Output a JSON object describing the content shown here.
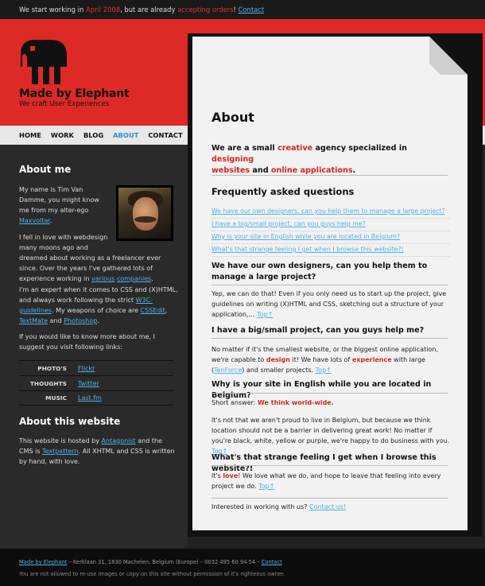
{
  "topbar": {
    "text1": "We start working in ",
    "date": "April 2008",
    "text2": ", but are already ",
    "accepting": "accepting orders",
    "text3": "! ",
    "contact": "Contact"
  },
  "brand": {
    "name": "Made by Elephant",
    "tagline": "We craft User Experiences"
  },
  "nav": {
    "items": [
      "HOME",
      "WORK",
      "BLOG",
      "ABOUT",
      "CONTACT"
    ],
    "active": "ABOUT"
  },
  "sidebar": {
    "about_title": "About me",
    "p1_a": "My name is Tim Van",
    "p1_b": "Damme, you might know",
    "p1_c": "me from my alter-ego",
    "p1_link": "Maxvoltar",
    "p1_end": ".",
    "p2_a": "I fell in love with webdesign",
    "p2_b": "many moons ago and",
    "p2_c": "dreamed about working as a freelancer ever",
    "p2_d": "since. Over the years I've gathered lots of",
    "p2_e": "experience working in ",
    "p2_link1": "various",
    "p2_link2": "companies",
    "p2_end": ".",
    "p3_a": "I'm an expert when it comes to CSS and (X)HTML,",
    "p3_b": "and always work following the strict ",
    "p3_link1": "W3C-",
    "p3_link1b": "guidelines",
    "p3_c": ". My weapons of choice are ",
    "p3_link2": "CSSEdit",
    "p3_link3": "TextMate",
    "p3_d": " and ",
    "p3_link4": "Photoshop",
    "p3_end": ".",
    "p4_a": "If you would like to know more about me, I",
    "p4_b": "suggest you visit following links:",
    "links": [
      {
        "label": "PHOTO'S",
        "link": "Flickr"
      },
      {
        "label": "THOUGHTS",
        "link": "Twitter"
      },
      {
        "label": "MUSIC",
        "link": "Last.fm"
      }
    ],
    "site_title": "About this website",
    "s_a": "This website is hosted by ",
    "s_link1": "Antagonist",
    "s_b": " and the",
    "s_c": "CMS is ",
    "s_link2": "Textpattern",
    "s_d": ". All XHTML and CSS is written",
    "s_e": "by hand, with love."
  },
  "content": {
    "title": "About",
    "intro_1": "We are a small ",
    "intro_creative": "creative",
    "intro_2": " agency specialized in ",
    "intro_designing": "designing",
    "intro_websites": "websites",
    "intro_3": " and ",
    "intro_apps": "online applications",
    "intro_4": ".",
    "faq_title": "Frequently asked questions",
    "faq": [
      "We have our own designers, can you help them to manage a large project?",
      "I have a big/small project, can you guys help me?",
      "Why is your site in English while you are located in Belgium?",
      "What's that strange feeling I get when I browse this website?!"
    ],
    "q1_title": "We have our own designers, can you help them to manage a large project?",
    "q1_a": "Yep, we can do that! Even if you only need us to start up the project, give guidelines on writing (X)HTML and CSS, sketching out a structure of your application,… ",
    "top": "Top↑",
    "q2_title": "I have a big/small project, can you guys help me?",
    "q2_a": "No matter if it's the smallest website, or the biggest online application, we're capable to ",
    "q2_design": "design",
    "q2_b": " it! We have lots of ",
    "q2_exp": "experience",
    "q2_c": " with large (",
    "q2_link": "TenForce",
    "q2_d": ") and smaller projects. ",
    "q3_title": "Why is your site in English while you are located in Belgium?",
    "q3_short": "Short answer: ",
    "q3_ww": "We think world-wide.",
    "q3_a": "It's not that we aren't proud to live in Belgium, but because we think location should not be a barrier in delivering great work! No matter if you're black, white, yellow or purple, we're happy to do business with you. ",
    "q4_title": "What's that strange feeling I get when I browse this website?!",
    "q4_a": "It's ",
    "q4_love": "love",
    "q4_b": "! We love what we do, and hope to leave that feeling into every project we do. ",
    "cta": "Interested in working with us? ",
    "cta_link": "Contact us!"
  },
  "footer": {
    "link1": "Made by Elephant",
    "address": " – Kerklaan 31, 1830 Machelen, Belgium (Europe) – 0032 495 60 94 54 – ",
    "link2": "Contact",
    "notice": "You are not allowed to re-use images or copy on this site without permission of it's righteous owner."
  },
  "colors": {
    "brand_red": "#dd2a26",
    "link_blue": "#4fb1e6",
    "accent_red": "#d2261f"
  }
}
